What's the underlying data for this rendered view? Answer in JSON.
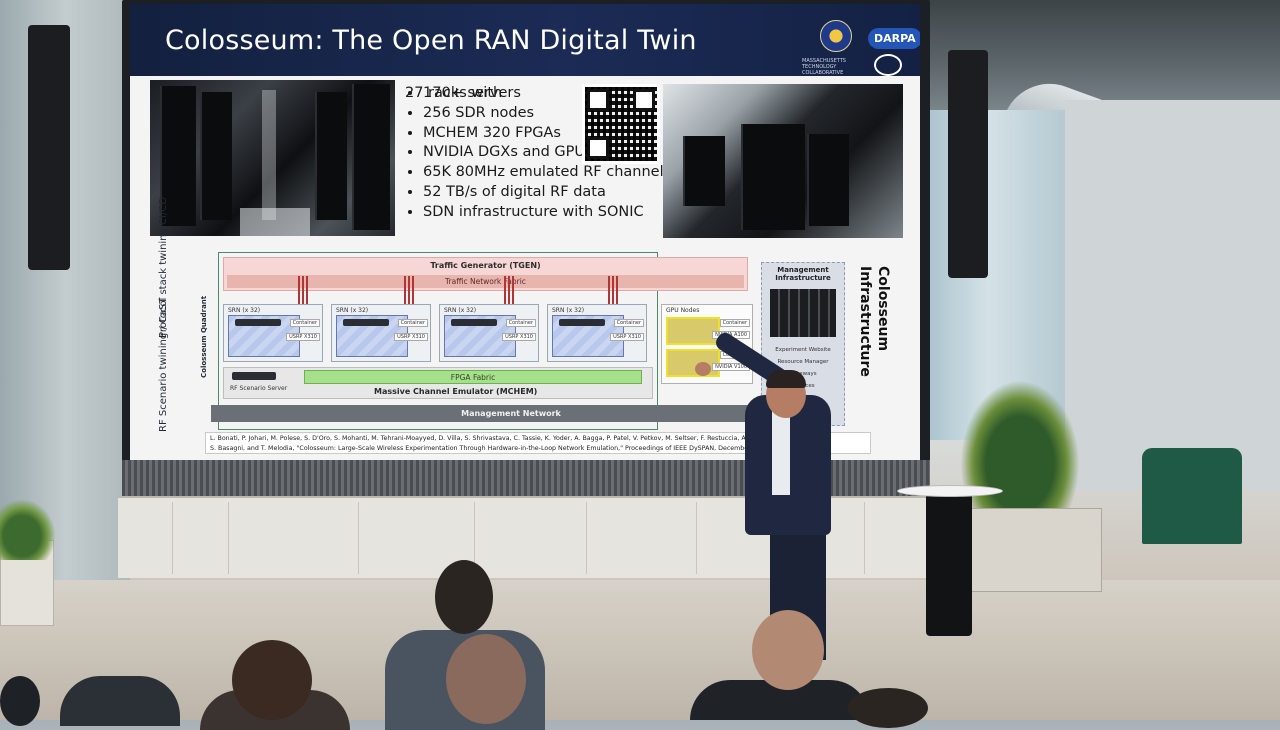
{
  "slide": {
    "title": "Colosseum: The Open RAN Digital Twin",
    "logos": {
      "darpa": "DARPA",
      "mtc": "MASSACHUSETTS TECHNOLOGY COLLABORATIVE"
    },
    "specs_heading": "27 racks with",
    "specs": [
      "170+ servers",
      "256 SDR nodes",
      "MCHEM 320 FPGAs",
      "NVIDIA DGXs and GPUs",
      "65K 80MHz emulated RF channels",
      "52 TB/s of digital RF data",
      "SDN infrastructure with SONIC"
    ],
    "diagram": {
      "side_label_top": "Protocol stack twining CI/CD",
      "side_label_bottom": "RF Scenario twining / CaST",
      "quadrant_label": "Colosseum Quadrant",
      "tgen": "Traffic Generator (TGEN)",
      "traffic_fabric": "Traffic Network Fabric",
      "srn_title": "SRN (x 32)",
      "srn_container": "Container",
      "srn_usrp": "USRP X310",
      "gpu_title": "GPU Nodes",
      "gpu_container": "Container",
      "gpu_a100": "NVIDIA A100",
      "gpu_v100": "NVIDIA V100",
      "fpga_fabric": "FPGA Fabric",
      "mchem": "Massive Channel Emulator (MCHEM)",
      "rf_server": "RF Scenario Server",
      "management_network": "Management Network",
      "mgmt_infra_title": "Management Infrastructure",
      "mgmt_items": [
        "Experiment Website",
        "Resource Manager",
        "Gateways",
        "Services",
        "Storage"
      ],
      "infra_label": "Colosseum Infrastructure"
    },
    "citation": [
      "L. Bonati, P. Johari, M. Polese, S. D'Oro, S. Mohanti, M. Tehrani-Moayyed, D. Villa, S. Shrivastava, C. Tassie, K. Yoder, A. Bagga, P. Patel, V. Petkov, M. Seltser, F. Restuccia, A. Gosain, K. Chowdhury,",
      "S. Basagni, and T. Melodia, \"Colosseum: Large-Scale Wireless Experimentation Through Hardware-in-the-Loop Network Emulation,\" Proceedings of IEEE DySPAN, December 2021."
    ]
  },
  "colors": {
    "title_bar": "#1b2b55",
    "tgen": "#f6d7d5",
    "fpga": "#a7e08d",
    "mgmt_network": "#6b6f76"
  }
}
